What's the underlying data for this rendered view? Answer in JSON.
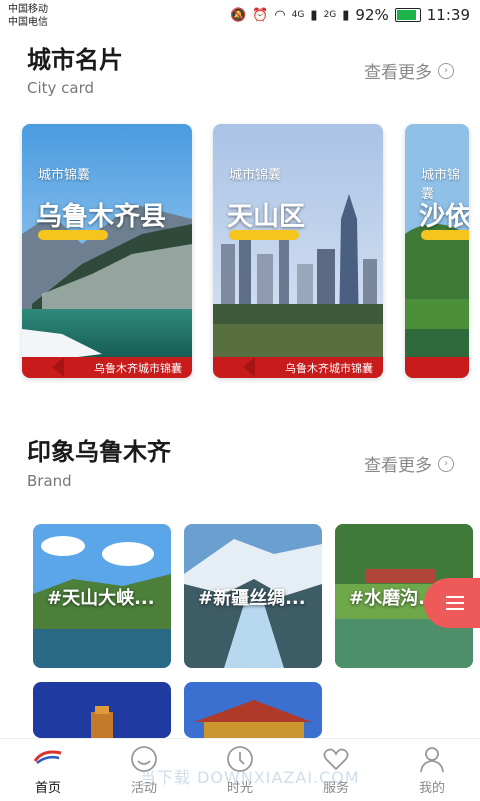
{
  "status": {
    "carrier1": "中国移动",
    "carrier2": "中国电信",
    "network1": "4G",
    "network2": "2G",
    "battery": "92%",
    "time": "11:39"
  },
  "city_section": {
    "title": "城市名片",
    "subtitle": "City card",
    "more": "查看更多"
  },
  "city_cards": [
    {
      "tag": "城市锦囊",
      "name": "乌鲁木齐县",
      "footer": "乌鲁木齐城市锦囊"
    },
    {
      "tag": "城市锦囊",
      "name": "天山区",
      "footer": "乌鲁木齐城市锦囊"
    },
    {
      "tag": "城市锦囊",
      "name": "沙依",
      "footer": ""
    }
  ],
  "brand_section": {
    "title": "印象乌鲁木齐",
    "subtitle": "Brand",
    "more": "查看更多"
  },
  "brand_items": [
    {
      "title": "#天山大峡..."
    },
    {
      "title": "#新疆丝绸..."
    },
    {
      "title": "#水磨沟..."
    }
  ],
  "tabs": [
    {
      "label": "首页",
      "icon": "home-logo-icon"
    },
    {
      "label": "活动",
      "icon": "smile-icon"
    },
    {
      "label": "时光",
      "icon": "clock-icon"
    },
    {
      "label": "服务",
      "icon": "heart-icon"
    },
    {
      "label": "我的",
      "icon": "user-icon"
    }
  ],
  "watermark": "当下载 DOWNXIAZAI.COM"
}
